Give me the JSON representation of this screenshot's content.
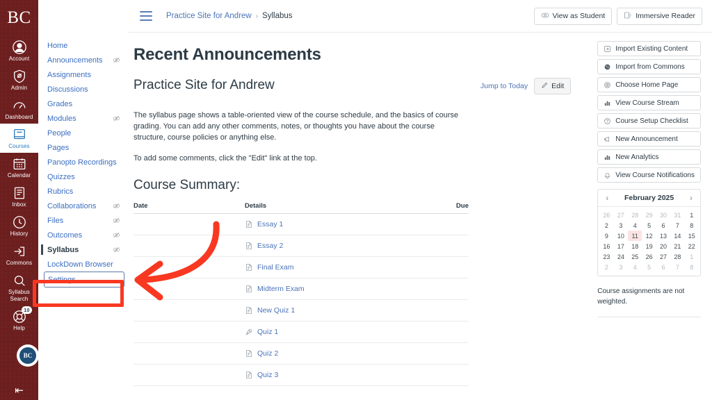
{
  "colors": {
    "brand_maroon": "#6d1f1f",
    "link_blue": "#4b73b8",
    "active_blue": "#2b7abc",
    "annotation_red": "#f93822",
    "today_highlight": "#fbe3e3"
  },
  "global_nav": {
    "logo": "BC",
    "items": [
      {
        "label": "Account",
        "icon": "account-icon",
        "active": false,
        "badge": null
      },
      {
        "label": "Admin",
        "icon": "admin-shield-icon",
        "active": false,
        "badge": null
      },
      {
        "label": "Dashboard",
        "icon": "dashboard-icon",
        "active": false,
        "badge": null
      },
      {
        "label": "Courses",
        "icon": "courses-book-icon",
        "active": true,
        "badge": null
      },
      {
        "label": "Calendar",
        "icon": "calendar-icon",
        "active": false,
        "badge": null
      },
      {
        "label": "Inbox",
        "icon": "inbox-icon",
        "active": false,
        "badge": null
      },
      {
        "label": "History",
        "icon": "history-clock-icon",
        "active": false,
        "badge": null
      },
      {
        "label": "Commons",
        "icon": "commons-icon",
        "active": false,
        "badge": null
      },
      {
        "label": "Syllabus Search",
        "icon": "magnifier-icon",
        "active": false,
        "badge": null
      },
      {
        "label": "Help",
        "icon": "help-life-preserver-icon",
        "active": false,
        "badge": "10"
      }
    ],
    "avatar_initials": "BC",
    "collapse_label": "⇤"
  },
  "course_nav": {
    "items": [
      {
        "label": "Home",
        "hidden_icon": false,
        "active": false,
        "focused": false
      },
      {
        "label": "Announcements",
        "hidden_icon": true,
        "active": false,
        "focused": false
      },
      {
        "label": "Assignments",
        "hidden_icon": false,
        "active": false,
        "focused": false
      },
      {
        "label": "Discussions",
        "hidden_icon": false,
        "active": false,
        "focused": false
      },
      {
        "label": "Grades",
        "hidden_icon": false,
        "active": false,
        "focused": false
      },
      {
        "label": "Modules",
        "hidden_icon": true,
        "active": false,
        "focused": false
      },
      {
        "label": "People",
        "hidden_icon": false,
        "active": false,
        "focused": false
      },
      {
        "label": "Pages",
        "hidden_icon": false,
        "active": false,
        "focused": false
      },
      {
        "label": "Panopto Recordings",
        "hidden_icon": false,
        "active": false,
        "focused": false
      },
      {
        "label": "Quizzes",
        "hidden_icon": false,
        "active": false,
        "focused": false
      },
      {
        "label": "Rubrics",
        "hidden_icon": false,
        "active": false,
        "focused": false
      },
      {
        "label": "Collaborations",
        "hidden_icon": true,
        "active": false,
        "focused": false
      },
      {
        "label": "Files",
        "hidden_icon": true,
        "active": false,
        "focused": false
      },
      {
        "label": "Outcomes",
        "hidden_icon": true,
        "active": false,
        "focused": false
      },
      {
        "label": "Syllabus",
        "hidden_icon": true,
        "active": true,
        "focused": false
      },
      {
        "label": "LockDown Browser",
        "hidden_icon": false,
        "active": false,
        "focused": false
      },
      {
        "label": "Settings",
        "hidden_icon": false,
        "active": false,
        "focused": true
      }
    ]
  },
  "topbar": {
    "hamburger_icon": "hamburger-menu-icon",
    "breadcrumb": {
      "course": "Practice Site for Andrew",
      "separator": "›",
      "current": "Syllabus"
    },
    "actions": [
      {
        "label": "View as Student",
        "icon": "eye-student-icon"
      },
      {
        "label": "Immersive Reader",
        "icon": "immersive-reader-icon"
      }
    ]
  },
  "main": {
    "page_title": "Recent Announcements",
    "course_title": "Practice Site for Andrew",
    "jump_to_today": "Jump to Today",
    "edit_button": "Edit",
    "paragraph_1": "The syllabus page shows a table-oriented view of the course schedule, and the basics of course grading. You can add any other comments, notes, or thoughts you have about the course structure, course policies or anything else.",
    "paragraph_2": "To add some comments, click the \"Edit\" link at the top.",
    "summary_title": "Course Summary:",
    "table": {
      "headers": {
        "date": "Date",
        "details": "Details",
        "due": "Due"
      },
      "rows": [
        {
          "date": "",
          "title": "Essay 1",
          "icon": "assignment-icon",
          "due": ""
        },
        {
          "date": "",
          "title": "Essay 2",
          "icon": "assignment-icon",
          "due": ""
        },
        {
          "date": "",
          "title": "Final Exam",
          "icon": "assignment-icon",
          "due": ""
        },
        {
          "date": "",
          "title": "Midterm Exam",
          "icon": "assignment-icon",
          "due": ""
        },
        {
          "date": "",
          "title": "New Quiz 1",
          "icon": "assignment-icon",
          "due": ""
        },
        {
          "date": "",
          "title": "Quiz 1",
          "icon": "quiz-rocket-icon",
          "due": ""
        },
        {
          "date": "",
          "title": "Quiz 2",
          "icon": "assignment-icon",
          "due": ""
        },
        {
          "date": "",
          "title": "Quiz 3",
          "icon": "assignment-icon",
          "due": ""
        }
      ]
    }
  },
  "sidebar": {
    "buttons": [
      {
        "label": "Import Existing Content",
        "icon": "import-arrow-icon"
      },
      {
        "label": "Import from Commons",
        "icon": "commons-sphere-icon"
      },
      {
        "label": "Choose Home Page",
        "icon": "target-icon"
      },
      {
        "label": "View Course Stream",
        "icon": "bar-chart-icon"
      },
      {
        "label": "Course Setup Checklist",
        "icon": "question-circle-icon"
      },
      {
        "label": "New Announcement",
        "icon": "megaphone-icon"
      },
      {
        "label": "New Analytics",
        "icon": "bar-chart-icon"
      },
      {
        "label": "View Course Notifications",
        "icon": "bell-icon"
      }
    ],
    "calendar": {
      "title": "February 2025",
      "prev_icon": "chevron-left-icon",
      "next_icon": "chevron-right-icon",
      "weeks": [
        [
          {
            "d": "26",
            "m": true
          },
          {
            "d": "27",
            "m": true
          },
          {
            "d": "28",
            "m": true
          },
          {
            "d": "29",
            "m": true
          },
          {
            "d": "30",
            "m": true
          },
          {
            "d": "31",
            "m": true
          },
          {
            "d": "1",
            "m": false
          }
        ],
        [
          {
            "d": "2",
            "m": false
          },
          {
            "d": "3",
            "m": false
          },
          {
            "d": "4",
            "m": false
          },
          {
            "d": "5",
            "m": false
          },
          {
            "d": "6",
            "m": false
          },
          {
            "d": "7",
            "m": false
          },
          {
            "d": "8",
            "m": false
          }
        ],
        [
          {
            "d": "9",
            "m": false
          },
          {
            "d": "10",
            "m": false
          },
          {
            "d": "11",
            "m": false,
            "today": true
          },
          {
            "d": "12",
            "m": false
          },
          {
            "d": "13",
            "m": false
          },
          {
            "d": "14",
            "m": false
          },
          {
            "d": "15",
            "m": false
          }
        ],
        [
          {
            "d": "16",
            "m": false
          },
          {
            "d": "17",
            "m": false
          },
          {
            "d": "18",
            "m": false
          },
          {
            "d": "19",
            "m": false
          },
          {
            "d": "20",
            "m": false
          },
          {
            "d": "21",
            "m": false
          },
          {
            "d": "22",
            "m": false
          }
        ],
        [
          {
            "d": "23",
            "m": false
          },
          {
            "d": "24",
            "m": false
          },
          {
            "d": "25",
            "m": false
          },
          {
            "d": "26",
            "m": false
          },
          {
            "d": "27",
            "m": false
          },
          {
            "d": "28",
            "m": false
          },
          {
            "d": "1",
            "m": true
          }
        ],
        [
          {
            "d": "2",
            "m": true
          },
          {
            "d": "3",
            "m": true
          },
          {
            "d": "4",
            "m": true
          },
          {
            "d": "5",
            "m": true
          },
          {
            "d": "6",
            "m": true
          },
          {
            "d": "7",
            "m": true
          },
          {
            "d": "8",
            "m": true
          }
        ]
      ]
    },
    "weighted_note": "Course assignments are not weighted."
  },
  "annotations": {
    "highlight_target": "Settings",
    "arrow": "curved-left-arrow"
  }
}
